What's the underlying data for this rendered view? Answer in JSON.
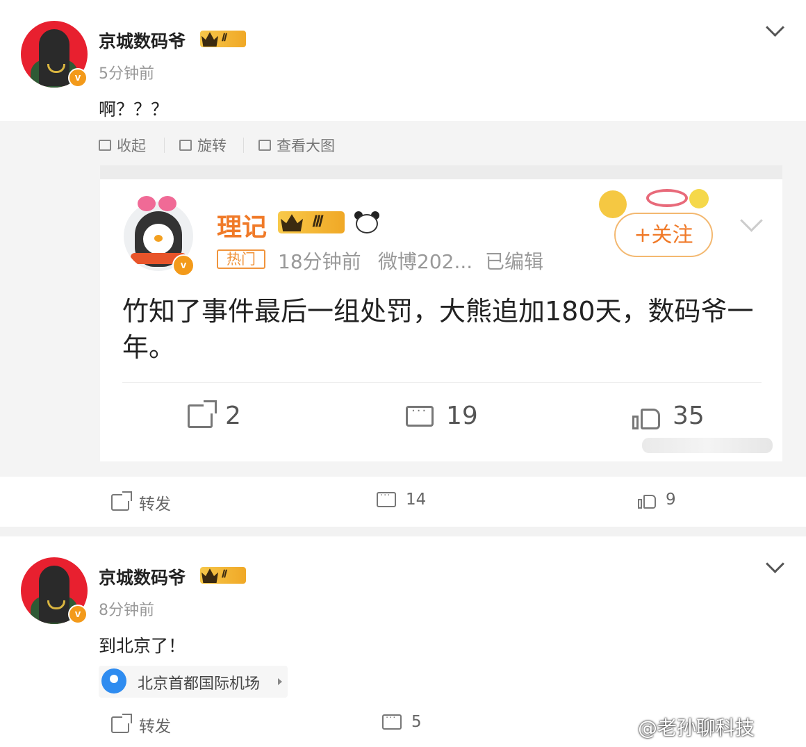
{
  "post1": {
    "username": "京城数码爷",
    "level": "Ⅱ",
    "time": "5分钟前",
    "text": "啊？？？",
    "toolbar": {
      "collapse": "收起",
      "rotate": "旋转",
      "view_large": "查看大图"
    },
    "quoted": {
      "username": "理记",
      "level": "Ⅲ",
      "hot_tag": "热门",
      "time": "18分钟前",
      "source": "微博202...",
      "edited": "已编辑",
      "follow": "+关注",
      "text": "竹知了事件最后一组处罚，大熊追加180天，数码爷一年。",
      "reposts": "2",
      "comments": "19",
      "likes": "35"
    },
    "actions": {
      "repost": "转发",
      "comments": "14",
      "likes": "9"
    }
  },
  "post2": {
    "username": "京城数码爷",
    "level": "Ⅱ",
    "time": "8分钟前",
    "text": "到北京了！",
    "location": "北京首都国际机场",
    "actions": {
      "repost": "转发",
      "comments": "5"
    }
  },
  "watermark": "@老孙聊科技"
}
